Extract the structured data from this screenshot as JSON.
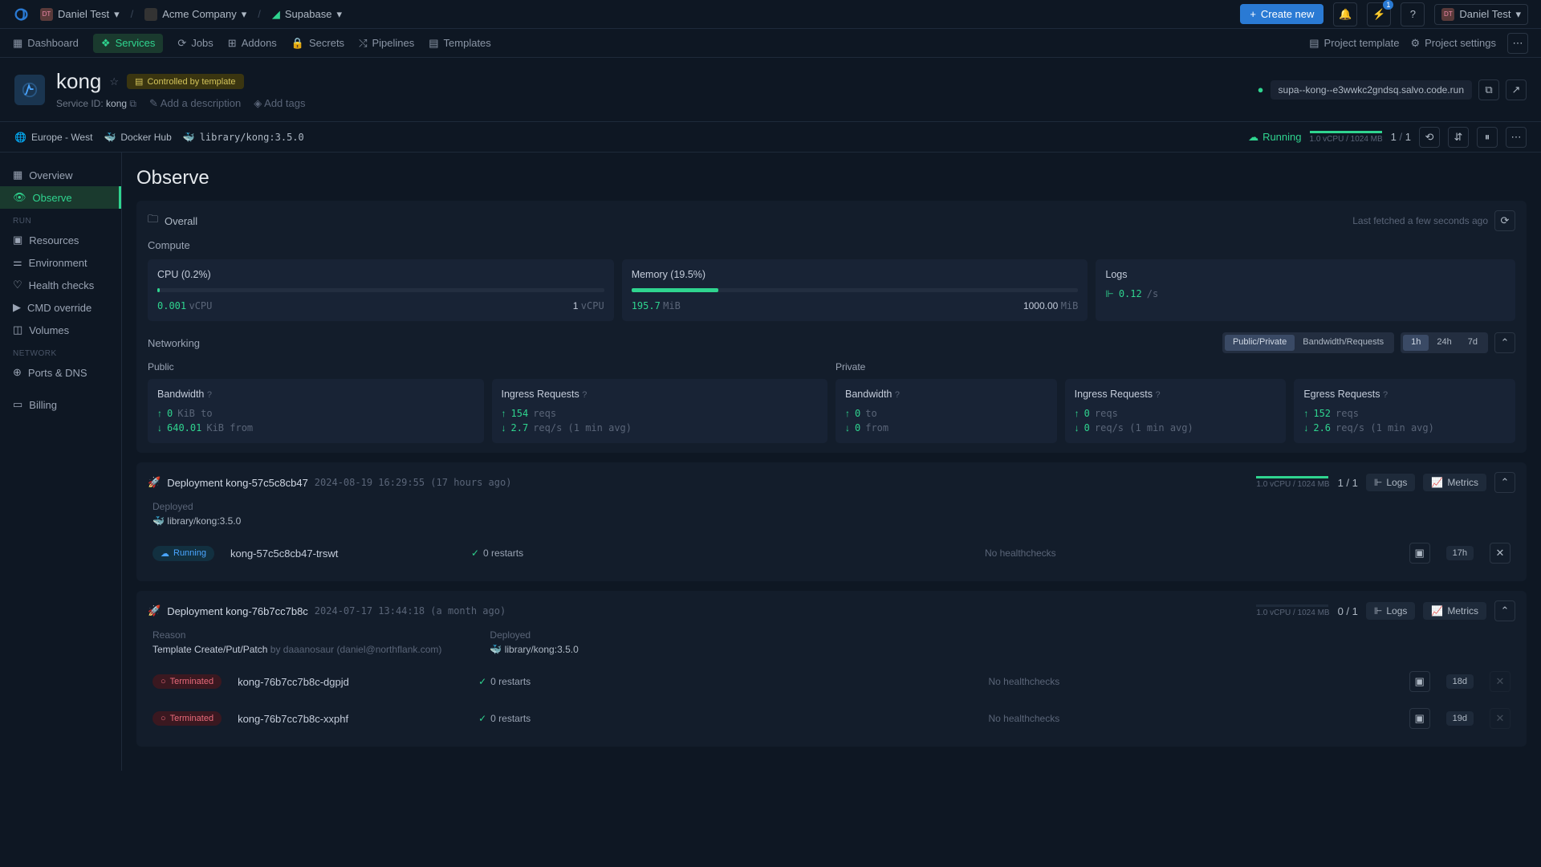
{
  "topbar": {
    "org": "Daniel Test",
    "company": "Acme Company",
    "project": "Supabase",
    "create_new": "Create new",
    "notif_count": "1",
    "user": "Daniel Test"
  },
  "nav": {
    "tabs": [
      "Dashboard",
      "Services",
      "Jobs",
      "Addons",
      "Secrets",
      "Pipelines",
      "Templates"
    ],
    "project_template": "Project template",
    "project_settings": "Project settings"
  },
  "service": {
    "name": "kong",
    "controlled": "Controlled by template",
    "id_label": "Service ID:",
    "id": "kong",
    "add_desc": "Add a description",
    "add_tags": "Add tags",
    "region": "Europe - West",
    "registry": "Docker Hub",
    "image": "library/kong:3.5.0",
    "host": "supa--kong--e3wwkc2gndsq.salvo.code.run"
  },
  "status": {
    "state": "Running",
    "spec": "1.0 vCPU / 1024 MB",
    "replicas_cur": "1",
    "replicas_sep": "/",
    "replicas_total": "1"
  },
  "sidebar": {
    "items": [
      {
        "label": "Overview"
      },
      {
        "label": "Observe"
      }
    ],
    "run_header": "RUN",
    "run_items": [
      "Resources",
      "Environment",
      "Health checks",
      "CMD override",
      "Volumes"
    ],
    "net_header": "NETWORK",
    "net_items": [
      "Ports & DNS"
    ],
    "billing": "Billing"
  },
  "page": {
    "title": "Observe",
    "overall": "Overall",
    "last_fetched": "Last fetched a few seconds ago",
    "compute": "Compute",
    "cpu_title": "CPU (0.2%)",
    "cpu_val": "0.001",
    "cpu_unit": "vCPU",
    "cpu_max": "1",
    "mem_title": "Memory (19.5%)",
    "mem_val": "195.7",
    "mem_unit": "MiB",
    "mem_max": "1000.00",
    "mem_max_unit": "MiB",
    "logs_title": "Logs",
    "logs_val": "0.12",
    "logs_unit": "/s",
    "networking": "Networking",
    "tog_pub_priv": "Public/Private",
    "tog_bw_req": "Bandwidth/Requests",
    "tog_times": [
      "1h",
      "24h",
      "7d"
    ],
    "public": "Public",
    "private": "Private",
    "bandwidth": "Bandwidth",
    "ingress_req": "Ingress Requests",
    "egress_req": "Egress Requests",
    "pub_bw_up": "0",
    "pub_bw_up_unit": "KiB to",
    "pub_bw_dn": "640.01",
    "pub_bw_dn_unit": "KiB from",
    "pub_ing_reqs": "154",
    "pub_ing_reqs_unit": "reqs",
    "pub_ing_rate": "2.7",
    "pub_ing_rate_unit": "req/s (1 min avg)",
    "priv_bw_up": "0",
    "priv_bw_up_unit": "to",
    "priv_bw_dn": "0",
    "priv_bw_dn_unit": "from",
    "priv_ing_reqs": "0",
    "priv_ing_reqs_unit": "reqs",
    "priv_ing_rate": "0",
    "priv_ing_rate_unit": "req/s (1 min avg)",
    "priv_eg_reqs": "152",
    "priv_eg_reqs_unit": "reqs",
    "priv_eg_rate": "2.6",
    "priv_eg_rate_unit": "req/s (1 min avg)"
  },
  "deployments": [
    {
      "title": "Deployment kong-57c5c8cb47",
      "ts": "2024-08-19 16:29:55 (17 hours ago)",
      "spec": "1.0 vCPU / 1024 MB",
      "rep_cur": "1",
      "rep_total": "1",
      "logs": "Logs",
      "metrics": "Metrics",
      "reason_label": "Deployed",
      "image": "library/kong:3.5.0",
      "pods": [
        {
          "status": "Running",
          "name": "kong-57c5c8cb47-trswt",
          "restarts": "0 restarts",
          "hc": "No healthchecks",
          "age": "17h"
        }
      ]
    },
    {
      "title": "Deployment kong-76b7cc7b8c",
      "ts": "2024-07-17 13:44:18 (a month ago)",
      "spec": "1.0 vCPU / 1024 MB",
      "rep_cur": "0",
      "rep_total": "1",
      "logs": "Logs",
      "metrics": "Metrics",
      "reason_label": "Reason",
      "reason_text": "Template Create/Put/Patch",
      "reason_by": "by daaanosaur (daniel@northflank.com)",
      "deployed_label": "Deployed",
      "image": "library/kong:3.5.0",
      "pods": [
        {
          "status": "Terminated",
          "name": "kong-76b7cc7b8c-dgpjd",
          "restarts": "0 restarts",
          "hc": "No healthchecks",
          "age": "18d"
        },
        {
          "status": "Terminated",
          "name": "kong-76b7cc7b8c-xxphf",
          "restarts": "0 restarts",
          "hc": "No healthchecks",
          "age": "19d"
        }
      ]
    }
  ]
}
